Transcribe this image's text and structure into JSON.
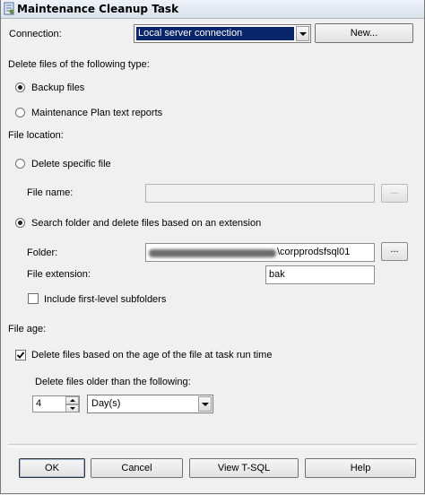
{
  "window": {
    "title": "Maintenance Cleanup Task"
  },
  "connection": {
    "label": "Connection:",
    "value": "Local server connection",
    "new_button": "New..."
  },
  "file_type": {
    "heading": "Delete files of the following type:",
    "options": [
      {
        "label": "Backup files",
        "selected": true
      },
      {
        "label": "Maintenance Plan text reports",
        "selected": false
      }
    ]
  },
  "file_location": {
    "heading": "File location:",
    "specific": {
      "label": "Delete specific file",
      "selected": false,
      "file_name_label": "File name:",
      "file_name_value": "",
      "browse_label": "..."
    },
    "folder_search": {
      "label": "Search folder and delete files based on an extension",
      "selected": true,
      "folder_label": "Folder:",
      "folder_value": "\\corpprodsfsql01",
      "browse_label": "...",
      "extension_label": "File extension:",
      "extension_value": "bak",
      "subfolders_label": "Include first-level subfolders",
      "subfolders_checked": false
    }
  },
  "file_age": {
    "heading": "File age:",
    "checkbox_label": "Delete files based on the age of the file at task run time",
    "checked": true,
    "older_than_label": "Delete files older than the following:",
    "amount": "4",
    "unit": "Day(s)"
  },
  "buttons": {
    "ok": "OK",
    "cancel": "Cancel",
    "view_tsql": "View T-SQL",
    "help": "Help"
  },
  "colors": {
    "selection_blue": "#0a246a",
    "window_bg": "#f0f0f0"
  }
}
